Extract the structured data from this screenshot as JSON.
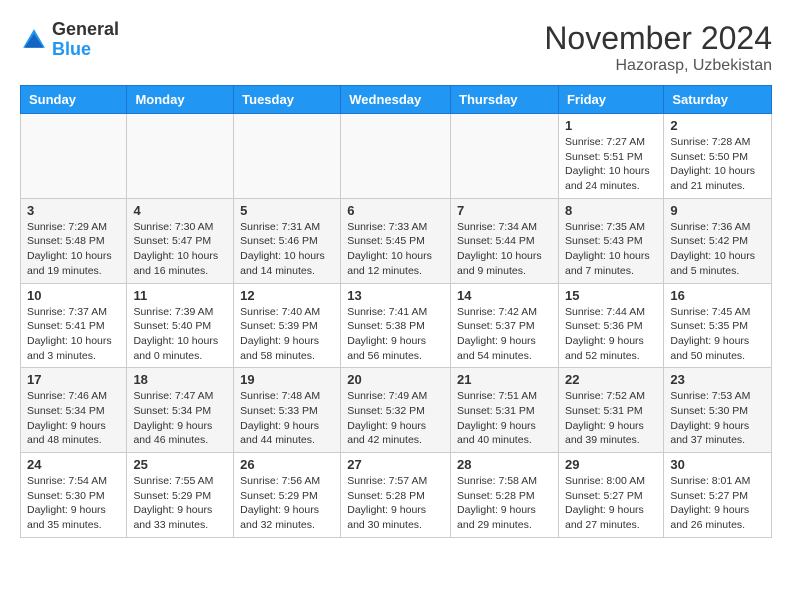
{
  "header": {
    "logo_general": "General",
    "logo_blue": "Blue",
    "month_title": "November 2024",
    "location": "Hazorasp, Uzbekistan"
  },
  "weekdays": [
    "Sunday",
    "Monday",
    "Tuesday",
    "Wednesday",
    "Thursday",
    "Friday",
    "Saturday"
  ],
  "weeks": [
    [
      {
        "day": "",
        "info": ""
      },
      {
        "day": "",
        "info": ""
      },
      {
        "day": "",
        "info": ""
      },
      {
        "day": "",
        "info": ""
      },
      {
        "day": "",
        "info": ""
      },
      {
        "day": "1",
        "info": "Sunrise: 7:27 AM\nSunset: 5:51 PM\nDaylight: 10 hours and 24 minutes."
      },
      {
        "day": "2",
        "info": "Sunrise: 7:28 AM\nSunset: 5:50 PM\nDaylight: 10 hours and 21 minutes."
      }
    ],
    [
      {
        "day": "3",
        "info": "Sunrise: 7:29 AM\nSunset: 5:48 PM\nDaylight: 10 hours and 19 minutes."
      },
      {
        "day": "4",
        "info": "Sunrise: 7:30 AM\nSunset: 5:47 PM\nDaylight: 10 hours and 16 minutes."
      },
      {
        "day": "5",
        "info": "Sunrise: 7:31 AM\nSunset: 5:46 PM\nDaylight: 10 hours and 14 minutes."
      },
      {
        "day": "6",
        "info": "Sunrise: 7:33 AM\nSunset: 5:45 PM\nDaylight: 10 hours and 12 minutes."
      },
      {
        "day": "7",
        "info": "Sunrise: 7:34 AM\nSunset: 5:44 PM\nDaylight: 10 hours and 9 minutes."
      },
      {
        "day": "8",
        "info": "Sunrise: 7:35 AM\nSunset: 5:43 PM\nDaylight: 10 hours and 7 minutes."
      },
      {
        "day": "9",
        "info": "Sunrise: 7:36 AM\nSunset: 5:42 PM\nDaylight: 10 hours and 5 minutes."
      }
    ],
    [
      {
        "day": "10",
        "info": "Sunrise: 7:37 AM\nSunset: 5:41 PM\nDaylight: 10 hours and 3 minutes."
      },
      {
        "day": "11",
        "info": "Sunrise: 7:39 AM\nSunset: 5:40 PM\nDaylight: 10 hours and 0 minutes."
      },
      {
        "day": "12",
        "info": "Sunrise: 7:40 AM\nSunset: 5:39 PM\nDaylight: 9 hours and 58 minutes."
      },
      {
        "day": "13",
        "info": "Sunrise: 7:41 AM\nSunset: 5:38 PM\nDaylight: 9 hours and 56 minutes."
      },
      {
        "day": "14",
        "info": "Sunrise: 7:42 AM\nSunset: 5:37 PM\nDaylight: 9 hours and 54 minutes."
      },
      {
        "day": "15",
        "info": "Sunrise: 7:44 AM\nSunset: 5:36 PM\nDaylight: 9 hours and 52 minutes."
      },
      {
        "day": "16",
        "info": "Sunrise: 7:45 AM\nSunset: 5:35 PM\nDaylight: 9 hours and 50 minutes."
      }
    ],
    [
      {
        "day": "17",
        "info": "Sunrise: 7:46 AM\nSunset: 5:34 PM\nDaylight: 9 hours and 48 minutes."
      },
      {
        "day": "18",
        "info": "Sunrise: 7:47 AM\nSunset: 5:34 PM\nDaylight: 9 hours and 46 minutes."
      },
      {
        "day": "19",
        "info": "Sunrise: 7:48 AM\nSunset: 5:33 PM\nDaylight: 9 hours and 44 minutes."
      },
      {
        "day": "20",
        "info": "Sunrise: 7:49 AM\nSunset: 5:32 PM\nDaylight: 9 hours and 42 minutes."
      },
      {
        "day": "21",
        "info": "Sunrise: 7:51 AM\nSunset: 5:31 PM\nDaylight: 9 hours and 40 minutes."
      },
      {
        "day": "22",
        "info": "Sunrise: 7:52 AM\nSunset: 5:31 PM\nDaylight: 9 hours and 39 minutes."
      },
      {
        "day": "23",
        "info": "Sunrise: 7:53 AM\nSunset: 5:30 PM\nDaylight: 9 hours and 37 minutes."
      }
    ],
    [
      {
        "day": "24",
        "info": "Sunrise: 7:54 AM\nSunset: 5:30 PM\nDaylight: 9 hours and 35 minutes."
      },
      {
        "day": "25",
        "info": "Sunrise: 7:55 AM\nSunset: 5:29 PM\nDaylight: 9 hours and 33 minutes."
      },
      {
        "day": "26",
        "info": "Sunrise: 7:56 AM\nSunset: 5:29 PM\nDaylight: 9 hours and 32 minutes."
      },
      {
        "day": "27",
        "info": "Sunrise: 7:57 AM\nSunset: 5:28 PM\nDaylight: 9 hours and 30 minutes."
      },
      {
        "day": "28",
        "info": "Sunrise: 7:58 AM\nSunset: 5:28 PM\nDaylight: 9 hours and 29 minutes."
      },
      {
        "day": "29",
        "info": "Sunrise: 8:00 AM\nSunset: 5:27 PM\nDaylight: 9 hours and 27 minutes."
      },
      {
        "day": "30",
        "info": "Sunrise: 8:01 AM\nSunset: 5:27 PM\nDaylight: 9 hours and 26 minutes."
      }
    ]
  ]
}
